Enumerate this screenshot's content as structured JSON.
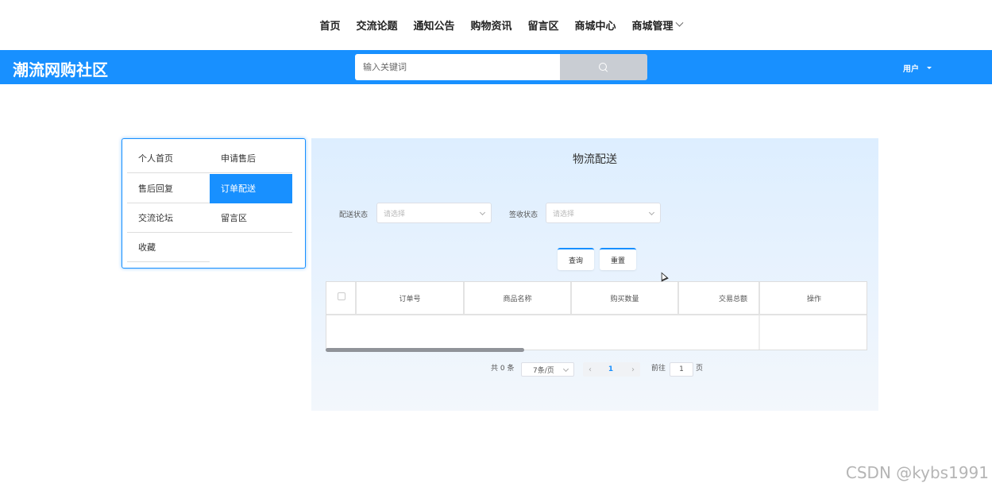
{
  "nav": {
    "items": [
      "首页",
      "交流论题",
      "通知公告",
      "购物资讯",
      "留言区",
      "商城中心",
      "商城管理"
    ]
  },
  "header": {
    "site_title": "潮流网购社区",
    "search_placeholder": "输入关键词",
    "user_label": "用户"
  },
  "sidebar": {
    "items": [
      "个人首页",
      "申请售后",
      "售后回复",
      "订单配送",
      "交流论坛",
      "留言区",
      "收藏"
    ],
    "active": "订单配送"
  },
  "main": {
    "title": "物流配送",
    "filters": [
      {
        "label": "配送状态",
        "placeholder": "请选择"
      },
      {
        "label": "签收状态",
        "placeholder": "请选择"
      }
    ],
    "buttons": {
      "search": "查询",
      "reset": "重置"
    },
    "table": {
      "columns": [
        "订单号",
        "商品名称",
        "购买数量",
        "交易总额",
        "操作"
      ],
      "rows": []
    },
    "pagination": {
      "total_text": "共 0 条",
      "page_size": "7条/页",
      "current_page": "1",
      "goto_label": "前往",
      "goto_value": "1",
      "page_suffix": "页"
    }
  },
  "watermark": "CSDN @kybs1991",
  "colors": {
    "accent": "#1890ff"
  }
}
